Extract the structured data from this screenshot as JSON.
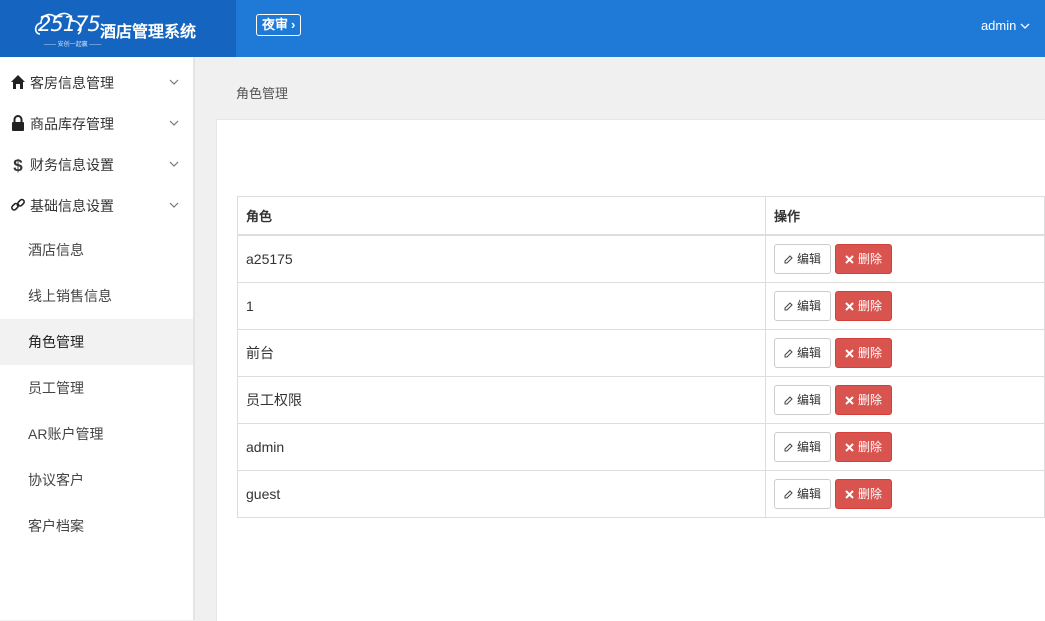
{
  "header": {
    "logo_number": "25175",
    "logo_tagline": "—— 安创一起赢 ——",
    "app_title": "酒店管理系统",
    "night_audit_label": "夜审",
    "user_name": "admin"
  },
  "sidebar": {
    "groups": [
      {
        "label": "客房信息管理",
        "icon": "home-icon"
      },
      {
        "label": "商品库存管理",
        "icon": "lock-icon"
      },
      {
        "label": "财务信息设置",
        "icon": "dollar-icon"
      },
      {
        "label": "基础信息设置",
        "icon": "link-icon"
      }
    ],
    "sub_items": [
      {
        "label": "酒店信息"
      },
      {
        "label": "线上销售信息"
      },
      {
        "label": "角色管理",
        "active": true
      },
      {
        "label": "员工管理"
      },
      {
        "label": "AR账户管理"
      },
      {
        "label": "协议客户"
      },
      {
        "label": "客户档案"
      }
    ]
  },
  "breadcrumb": "角色管理",
  "table": {
    "headers": {
      "role": "角色",
      "actions": "操作"
    },
    "edit_label": "编辑",
    "delete_label": "删除",
    "rows": [
      {
        "role": "a25175"
      },
      {
        "role": "1"
      },
      {
        "role": "前台"
      },
      {
        "role": "员工权限"
      },
      {
        "role": "admin"
      },
      {
        "role": "guest"
      }
    ]
  },
  "colors": {
    "header_bg": "#1e7ad6",
    "logo_bg": "#1565c0",
    "danger": "#d9534f"
  }
}
